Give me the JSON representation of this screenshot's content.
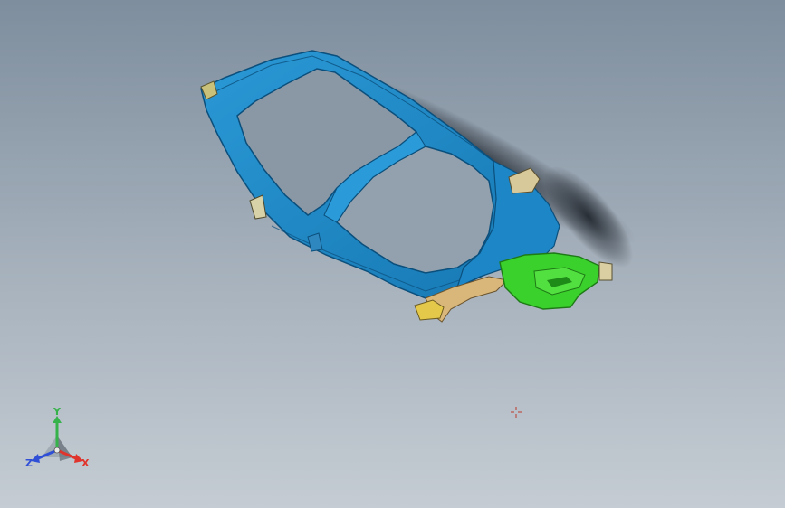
{
  "viewport": {
    "background_top": "#7e8e9e",
    "background_bottom": "#c5ccd3"
  },
  "model": {
    "frame_color": "#1f86c4",
    "frame_dark": "#0e5d8e",
    "bracket_color": "#3bd12c",
    "bracket_dark": "#1e8a18",
    "insert_color": "#e3c84a"
  },
  "triad": {
    "x_label": "X",
    "y_label": "Y",
    "z_label": "Z",
    "x_color": "#e0332b",
    "y_color": "#35b24a",
    "z_color": "#2f4fd6"
  },
  "cursor": {
    "icon": "crosshair-icon"
  }
}
